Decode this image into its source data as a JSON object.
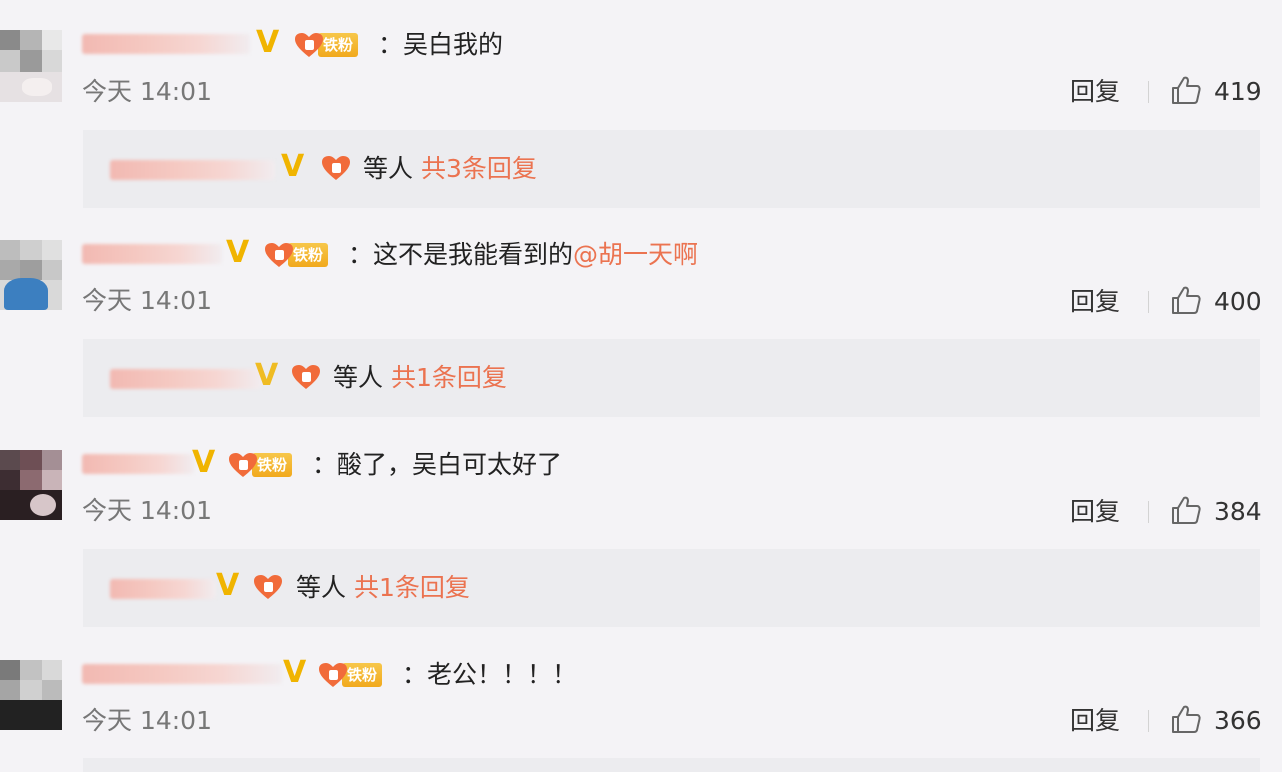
{
  "fan_label": "铁粉",
  "reply_label": "回复",
  "others_label": "等人",
  "comments": [
    {
      "text": "吴白我的",
      "mention": "",
      "time": "今天 14:01",
      "likes": "419",
      "reply_summary": "共3条回复"
    },
    {
      "text": "这不是我能看到的",
      "mention": "@胡一天啊",
      "time": "今天 14:01",
      "likes": "400",
      "reply_summary": "共1条回复"
    },
    {
      "text": "酸了，吴白可太好了",
      "mention": "",
      "time": "今天 14:01",
      "likes": "384",
      "reply_summary": "共1条回复"
    },
    {
      "text": "老公！！！！",
      "mention": "",
      "time": "今天 14:01",
      "likes": "366",
      "reply_summary": ""
    }
  ],
  "colors": {
    "accent": "#eb7350",
    "v_badge": "#f0b400",
    "fan_badge": "#f1a91d",
    "background": "#f4f3f6",
    "reply_box": "#ececef"
  },
  "icons": {
    "verified": "V",
    "like": "thumbs-up-icon",
    "fan": "heart-icon"
  }
}
